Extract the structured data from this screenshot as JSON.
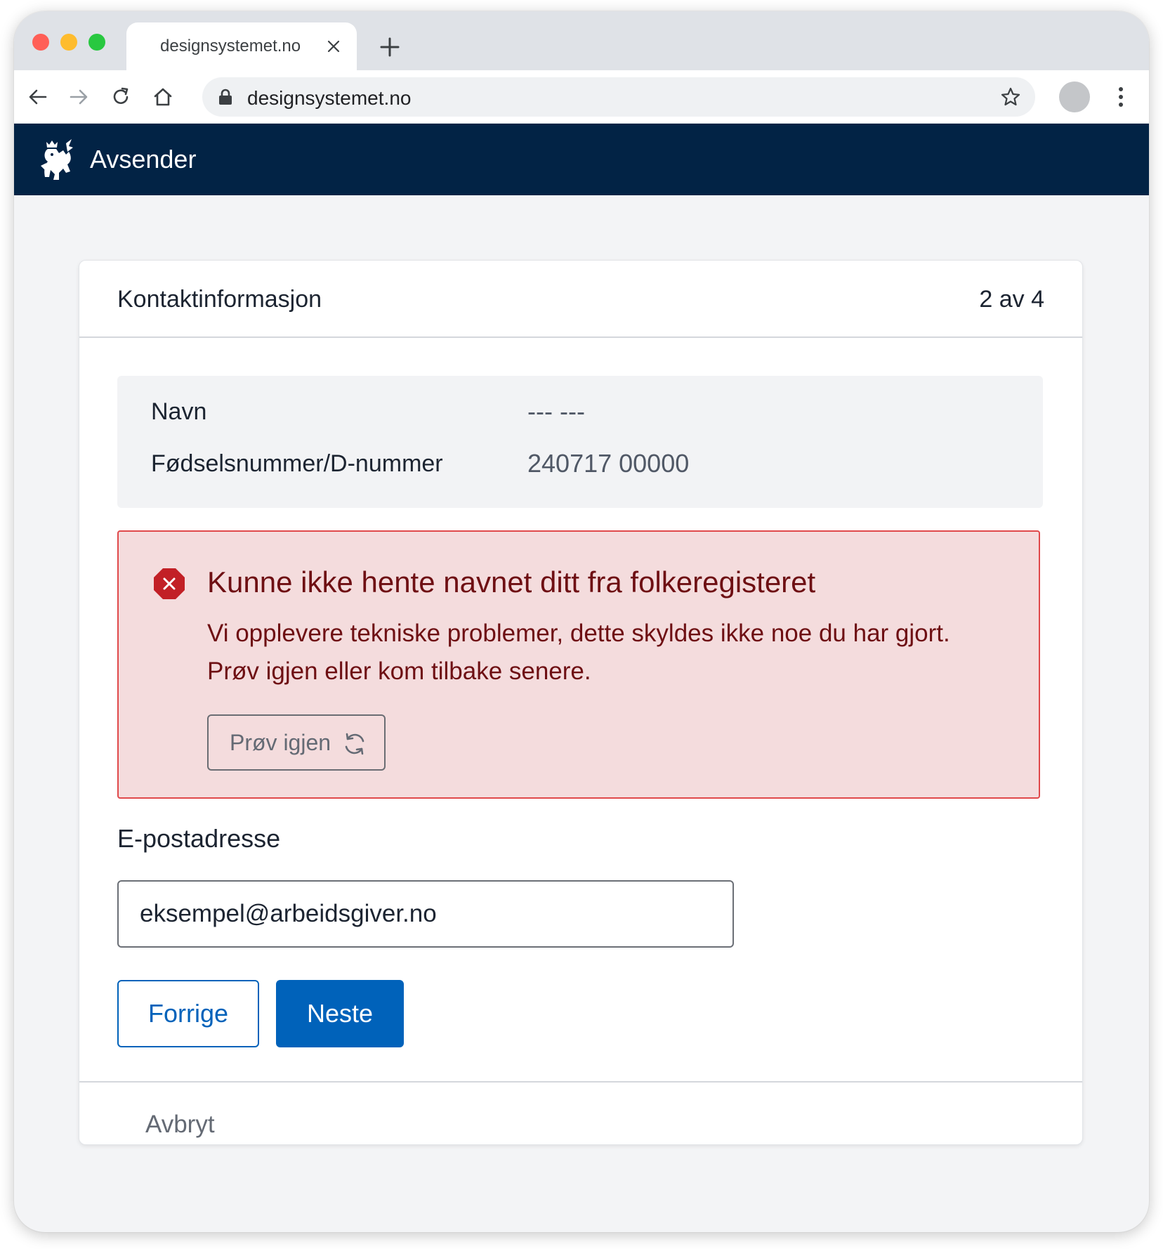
{
  "browser": {
    "tab_title": "designsystemet.no",
    "url": "designsystemet.no"
  },
  "app": {
    "title": "Avsender"
  },
  "card": {
    "title": "Kontaktinformasjon",
    "step": "2 av 4",
    "info": [
      {
        "label": "Navn",
        "value": "--- ---"
      },
      {
        "label": "Fødselsnummer/D-nummer",
        "value": "240717 00000"
      }
    ],
    "alert": {
      "title": "Kunne ikke hente navnet ditt fra folkeregisteret",
      "body": "Vi opplevere tekniske problemer, dette skyldes ikke noe du har gjort. Prøv igjen eller kom tilbake senere.",
      "retry_label": "Prøv igjen",
      "retry_icon": "refresh-icon",
      "icon": "error-octagon-icon"
    },
    "email": {
      "label": "E-postadresse",
      "value": "eksempel@arbeidsgiver.no"
    },
    "buttons": {
      "prev": "Forrige",
      "next": "Neste"
    },
    "cancel": "Avbryt"
  },
  "colors": {
    "header_bg": "#022345",
    "primary": "#0062ba",
    "alert_bg": "#f4dcdd",
    "alert_border": "#e0494b",
    "alert_text": "#6e0f13"
  }
}
